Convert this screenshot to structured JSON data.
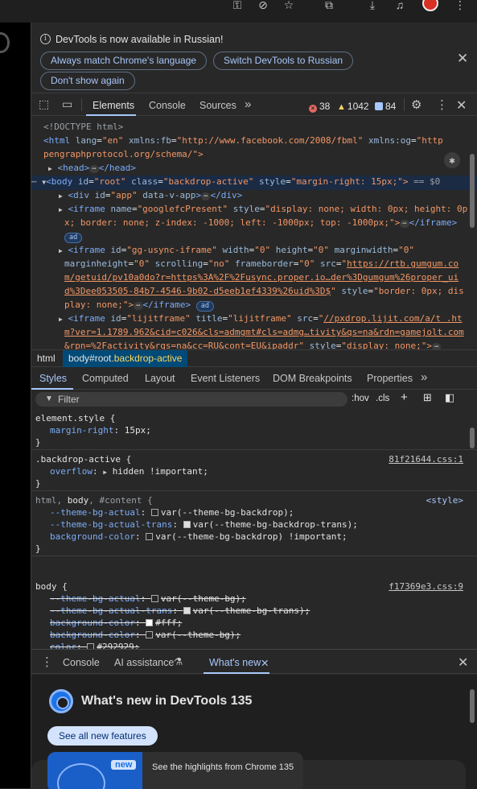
{
  "colors": {
    "accent": "#a8c7fa",
    "error": "#e46962",
    "warning": "#fdd663",
    "selected_bg": "#004a77"
  },
  "infobar": {
    "message": "DevTools is now available in Russian!",
    "buttons": [
      "Always match Chrome's language",
      "Switch DevTools to Russian",
      "Don't show again"
    ]
  },
  "toolbar": {
    "tabs": [
      "Elements",
      "Console",
      "Sources"
    ],
    "more": "»",
    "counts": {
      "errors": "38",
      "warnings": "1042",
      "info": "84"
    }
  },
  "dom": {
    "doctype": "<!DOCTYPE html>",
    "html_tag": "<html",
    "html_lang_attr": "lang",
    "html_lang_val": "\"en\"",
    "html_xmlnsfb_attr": "xmlns:fb",
    "html_xmlnsfb_val": "\"http://www.facebook.com/2008/fbml\"",
    "html_xmlnsog_attr": "xmlns:og",
    "html_xmlnsog_val": "\"http",
    "html_cont": "pengraphprotocol.org/schema/\">",
    "head_open": "<head>",
    "head_close": "</head>",
    "body_tag": "<body",
    "body_id_attr": "id",
    "body_id_val": "\"root\"",
    "body_class_attr": "class",
    "body_class_val": "\"backdrop-active\"",
    "body_style_attr": "style",
    "body_style_val": "\"margin-right: 15px;\">",
    "body_eq": "== $0",
    "div_tag": "<div",
    "div_id_attr": "id",
    "div_id_val": "\"app\"",
    "div_data_attr": "data-v-app",
    "div_close": "</div>",
    "iframe1_tag": "<iframe",
    "iframe1_name_attr": "name",
    "iframe1_name_val": "\"googlefcPresent\"",
    "iframe1_style_attr": "style",
    "iframe1_style_val1": "\"display: none; width: 0px; height: 0p",
    "iframe1_style_val2": "x; border: none; z-index: -1000; left: -1000px; top: -1000px;\">",
    "iframe_close": "</iframe>",
    "ad_badge": "ad",
    "iframe2_tag": "<iframe",
    "iframe2_id_attr": "id",
    "iframe2_id_val": "\"gg-usync-iframe\"",
    "iframe2_width_attr": "width",
    "iframe2_width_val": "\"0\"",
    "iframe2_height_attr": "height",
    "iframe2_height_val": "\"0\"",
    "iframe2_mw_attr": "marginwidth",
    "iframe2_mw_val": "\"0\"",
    "iframe2_mh_attr": "marginheight",
    "iframe2_mh_val": "\"0\"",
    "iframe2_scroll_attr": "scrolling",
    "iframe2_scroll_val": "\"no\"",
    "iframe2_fb_attr": "frameborder",
    "iframe2_fb_val": "\"0\"",
    "iframe2_src_attr": "src",
    "iframe2_src_q": "\"",
    "iframe2_src1": "https://rtb.gumgum.co",
    "iframe2_src2": "m/getuid/pv10a0do?r=https%3A%2F%2Fusync.proper.io…der%3Dgumgum%26proper_ui",
    "iframe2_src3": "d%3Dee053505-84b7-4546-9b02-d5eeb1ef4339%26uid%3D$",
    "iframe2_style_attr": "style",
    "iframe2_style_val1": "\"border: 0px; dis",
    "iframe2_style_val2": "play: none;\">",
    "iframe3_tag": "<iframe",
    "iframe3_id_attr": "id",
    "iframe3_id_val": "\"lijitframe\"",
    "iframe3_title_attr": "title",
    "iframe3_title_val": "\"lijitframe\"",
    "iframe3_src_attr": "src",
    "iframe3_src1": "//pxdrop.lijit.com/a/t .ht",
    "iframe3_src2": "m?ver=1.1789.962&cid=c026&cls=admgmt#cls=admg…tivity&qs=na&rdn=gamejolt.com",
    "iframe3_src3": "&rpn=%2Factivity&rqs=na&cc=RU&cont=EU&ipaddr",
    "iframe3_style_attr": "style",
    "iframe3_style_val": "\"display: none;\">"
  },
  "breadcrumb": {
    "html": "html",
    "body_tag": "body",
    "body_id": "#root",
    "body_class": ".backdrop-active"
  },
  "styles_tabs": [
    "Styles",
    "Computed",
    "Layout",
    "Event Listeners",
    "DOM Breakpoints",
    "Properties"
  ],
  "filter": {
    "placeholder": "Filter",
    "hov": ":hov",
    "cls": ".cls"
  },
  "rules": {
    "r1_selector": "element.style {",
    "r1_p1_name": "margin-right",
    "r1_p1_val": "15px;",
    "close": "}",
    "r2_selector": ".backdrop-active {",
    "r2_source": "81f21644.css:1",
    "r2_p1_name": "overflow",
    "r2_p1_val": "hidden !important;",
    "r3_sel_a": "html, ",
    "r3_sel_b": "body",
    "r3_sel_c": ", #content {",
    "r3_source": "<style>",
    "r3_p1_name": "--theme-bg-actual",
    "r3_p1_val": "var(--theme-bg-backdrop);",
    "r3_p2_name": "--theme-bg-actual-trans",
    "r3_p2_val": "var(--theme-bg-backdrop-trans);",
    "r3_p3_name": "background-color",
    "r3_p3_val": "var(--theme-bg-backdrop) !important;",
    "r4_selector": "body {",
    "r4_source": "f17369e3.css:9",
    "r4_p1_name": "--theme-bg-actual",
    "r4_p1_val": "var(--theme-bg);",
    "r4_p2_name": "--theme-bg-actual-trans",
    "r4_p2_val": "var(--theme-bg-trans);",
    "r4_p3_name": "background-color",
    "r4_p3_val": "#fff;",
    "r4_p4_name": "background-color",
    "r4_p4_val": "var(--theme-bg);",
    "r4_p5_name": "color",
    "r4_p5_val": "#292929;"
  },
  "drawer": {
    "tabs": [
      "Console",
      "AI assistance",
      "What's new"
    ],
    "title": "What's new in DevTools 135",
    "button": "See all new features",
    "badge": "new",
    "highlight": "See the highlights from Chrome 135"
  }
}
